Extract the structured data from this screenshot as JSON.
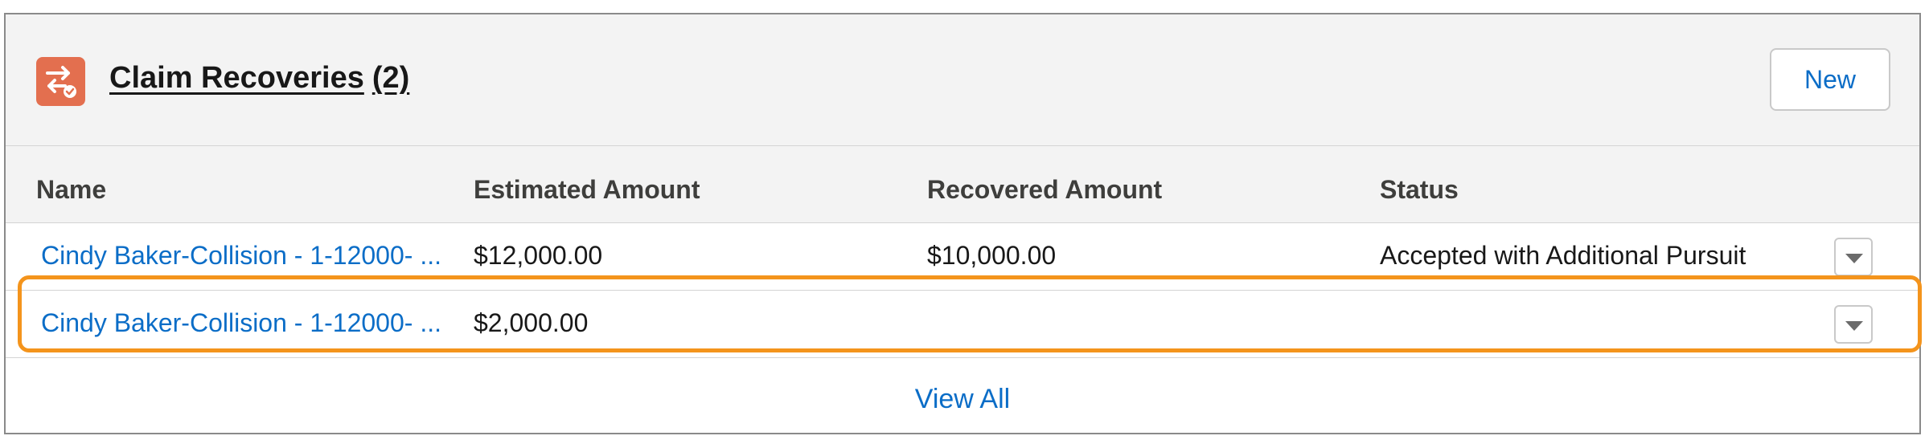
{
  "card": {
    "icon": "claim-recovery-icon",
    "title": "Claim Recoveries",
    "count": "(2)",
    "new_label": "New"
  },
  "table": {
    "columns": [
      "Name",
      "Estimated Amount",
      "Recovered Amount",
      "Status"
    ],
    "rows": [
      {
        "name": "Cindy Baker-Collision - 1-12000- ...",
        "estimated_amount": "$12,000.00",
        "recovered_amount": "$10,000.00",
        "status": "Accepted with Additional Pursuit"
      },
      {
        "name": "Cindy Baker-Collision - 1-12000- ...",
        "estimated_amount": "$2,000.00",
        "recovered_amount": "",
        "status": ""
      }
    ]
  },
  "footer": {
    "view_all_label": "View All"
  },
  "colors": {
    "icon_bg": "#e36f4f",
    "link": "#0b6dc7",
    "highlight": "#f4941c"
  }
}
